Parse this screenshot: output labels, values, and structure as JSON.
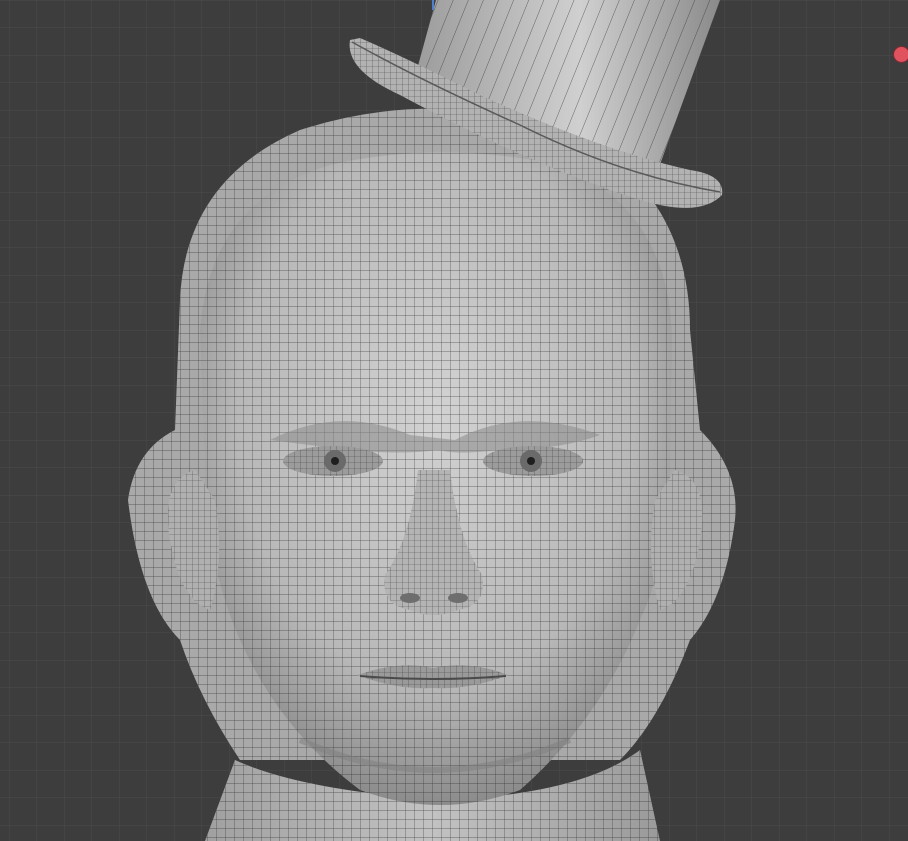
{
  "viewport": {
    "type": "3D viewport (solid shading with wireframe overlay)",
    "background_color": "#3d3d3d",
    "grid_color": "#4a4a4a",
    "mesh_color": "#c4c4c4",
    "wire_color": "#1e1e1e"
  },
  "scene": {
    "objects": [
      {
        "name_icon": "head-mesh-icon",
        "kind": "head"
      },
      {
        "name_icon": "top-hat-mesh-icon",
        "kind": "top-hat"
      }
    ]
  },
  "gizmo": {
    "x_axis_color": "#e0525e",
    "z_axis_color": "#4f7fd0"
  }
}
